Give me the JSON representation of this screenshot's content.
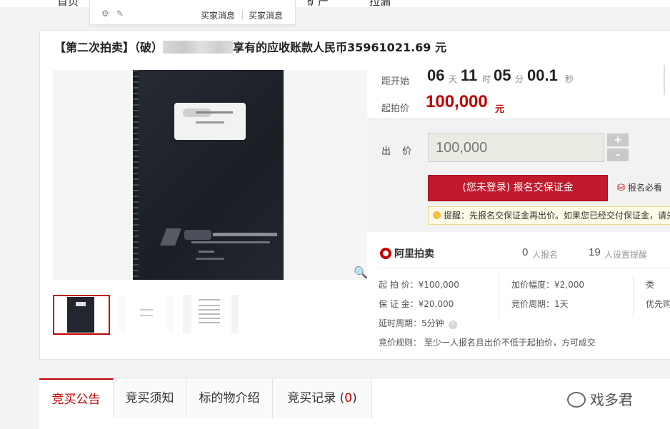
{
  "top_nav": {
    "home": "首页",
    "item2": "矿产",
    "item3": "拉漏"
  },
  "dropdown": {
    "link1": "买家消息",
    "link2": "买家消息"
  },
  "auction": {
    "title_prefix": "【第二次拍卖】（破）",
    "title_suffix": "享有的应收账款人民币35961021.69 元"
  },
  "countdown": {
    "label": "距开始",
    "days": "06",
    "days_unit": "天",
    "hours": "11",
    "hours_unit": "时",
    "minutes": "05",
    "minutes_unit": "分",
    "seconds": "00.1",
    "seconds_unit": "秒"
  },
  "start_price": {
    "label": "起拍价",
    "value": "100,000",
    "unit": "元"
  },
  "bid": {
    "label": "出 价",
    "input_value": "100,000",
    "plus": "+",
    "minus": "-",
    "register_button": "(您未登录) 报名交保证金",
    "must_read": "报名必看",
    "tip": "提醒：先报名交保证金再出价。如果您已经交付保证金，请先登录"
  },
  "stats": {
    "brand": "阿里拍卖",
    "registered_count": "0",
    "registered_label": "人报名",
    "reminders_count": "19",
    "reminders_label": "人设置提醒"
  },
  "details": {
    "start_price": "起 拍 价：¥100,000",
    "increment": "加价幅度：¥2,000",
    "category": "类",
    "deposit": "保 证 金：¥20,000",
    "bid_period": "竞价周期：1天",
    "priority": "优先购",
    "delay_period": "延时周期：5分钟",
    "help": "?",
    "rule": "竞价规则：  至少一人报名且出价不低于起拍价，方可成交"
  },
  "tabs": [
    {
      "label": "竞买公告"
    },
    {
      "label": "竞买须知"
    },
    {
      "label": "标的物介绍"
    },
    {
      "label": "竞买记录 (",
      "count": "0",
      "suffix": ")"
    }
  ],
  "watermark": "戏多君"
}
